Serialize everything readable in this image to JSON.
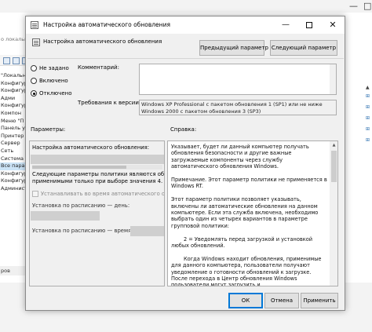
{
  "background": {
    "path": "о локальн",
    "tree": [
      "\"Локальн",
      "Конфигура",
      "Конфигура",
      "Адми",
      "Конфигура",
      "Компон",
      "Меню \"П",
      "Панель у",
      "Принтер",
      "Сервер",
      "Сеть",
      "Система",
      "Все парам",
      "Конфигура",
      "Конфигура",
      "Админист"
    ],
    "status": "ров"
  },
  "dialog": {
    "title": "Настройка автоматического обновления",
    "window_controls": {
      "minimize": "—",
      "close": "✕"
    },
    "header": {
      "policy_name": "Настройка автоматического обновления",
      "prev_button": "Предыдущий параметр",
      "next_button": "Следующий параметр"
    },
    "state": {
      "options": [
        {
          "label": "Не задано",
          "selected": false
        },
        {
          "label": "Включено",
          "selected": false
        },
        {
          "label": "Отключено",
          "selected": true
        }
      ]
    },
    "comment_label": "Комментарий:",
    "requirements_label": "Требования к версии:",
    "requirements_text": "Windows XP Professional с пакетом обновления 1 (SP1) или не ниже Windows 2000 с пакетом обновления 3 (SP3)",
    "options_label": "Параметры:",
    "help_label": "Справка:",
    "options_pane": {
      "configure_label": "Настройка автоматического обновления:",
      "note_line1": "Следующие параметры политики являются обязатель",
      "note_line2": "применимыми только при выборе значения 4.",
      "install_during_maintenance": "Устанавливать во время автоматического обслуж",
      "day_label": "Установка по расписанию — день:",
      "time_label": "Установка по расписанию — время:"
    },
    "help_paragraphs": [
      "Указывает, будет ли данный компьютер получать обновления безопасности и другие важные загружаемые компоненты через службу автоматического обновления Windows.",
      "Примечание. Этот параметр политики не применяется в Windows RT.",
      "Этот параметр политики позволяет указывать, включены ли автоматические обновления на данном компьютере. Если эта служба включена, необходимо выбрать один из четырех вариантов в параметре групповой политики:",
      "2 = Уведомлять перед загрузкой и установкой любых обновлений.",
      "Когда Windows находит обновления, применимые для данного компьютера, пользователи получают уведомление о готовности обновлений к загрузке. После перехода в Центр обновления Windows пользователи могут загрузить и"
    ],
    "footer": {
      "ok": "ОК",
      "cancel": "Отмена",
      "apply": "Применить"
    }
  }
}
